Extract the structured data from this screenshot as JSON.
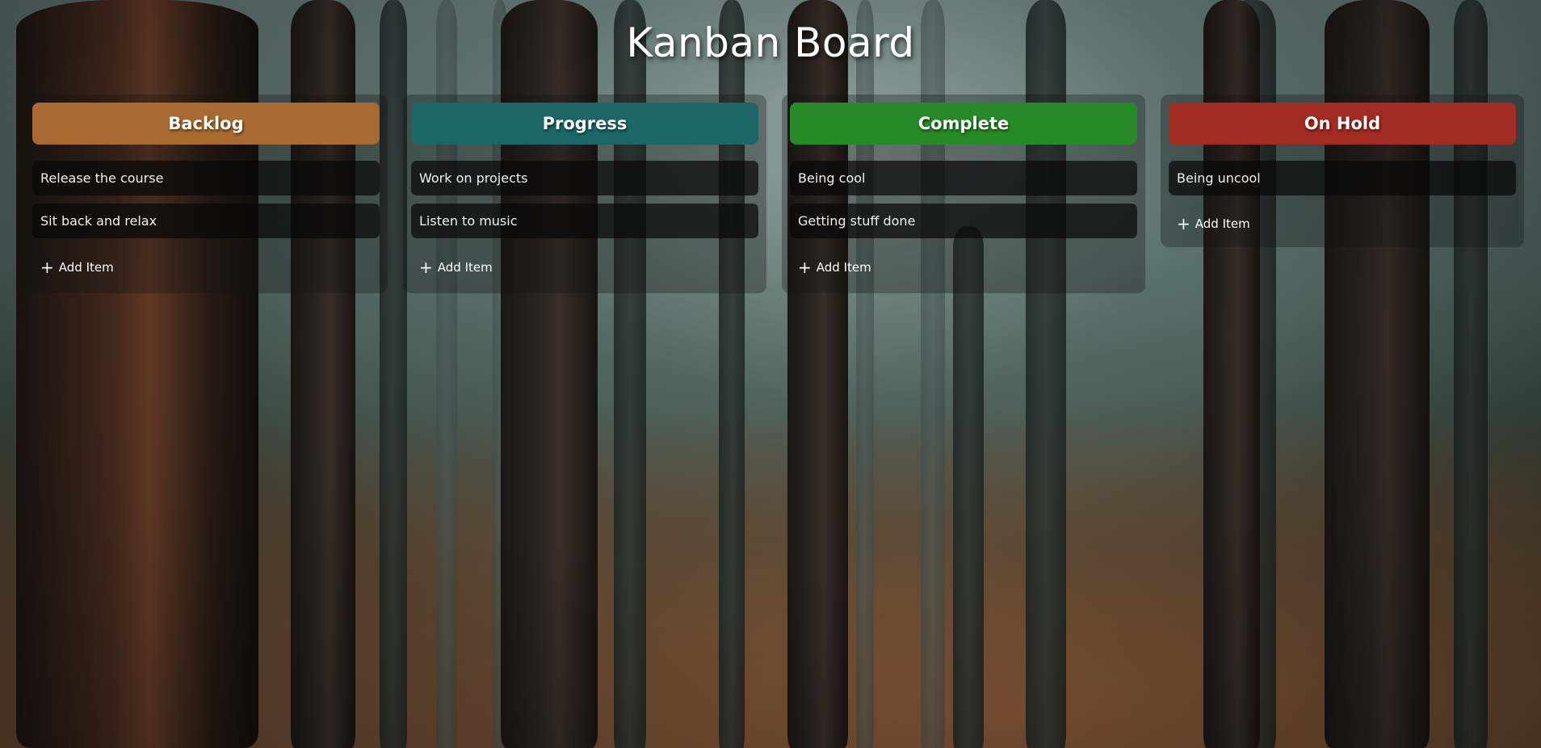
{
  "page": {
    "title": "Kanban Board"
  },
  "columns": [
    {
      "title": "Backlog",
      "color": "#a86a30",
      "items": [
        "Release the course",
        "Sit back and relax"
      ],
      "add_label": "Add Item"
    },
    {
      "title": "Progress",
      "color": "#1d6667",
      "items": [
        "Work on projects",
        "Listen to music"
      ],
      "add_label": "Add Item"
    },
    {
      "title": "Complete",
      "color": "#268a27",
      "items": [
        "Being cool",
        "Getting stuff done"
      ],
      "add_label": "Add Item"
    },
    {
      "title": "On Hold",
      "color": "#a22b22",
      "items": [
        "Being uncool"
      ],
      "add_label": "Add Item"
    }
  ],
  "icons": {
    "add": "plus-icon"
  }
}
